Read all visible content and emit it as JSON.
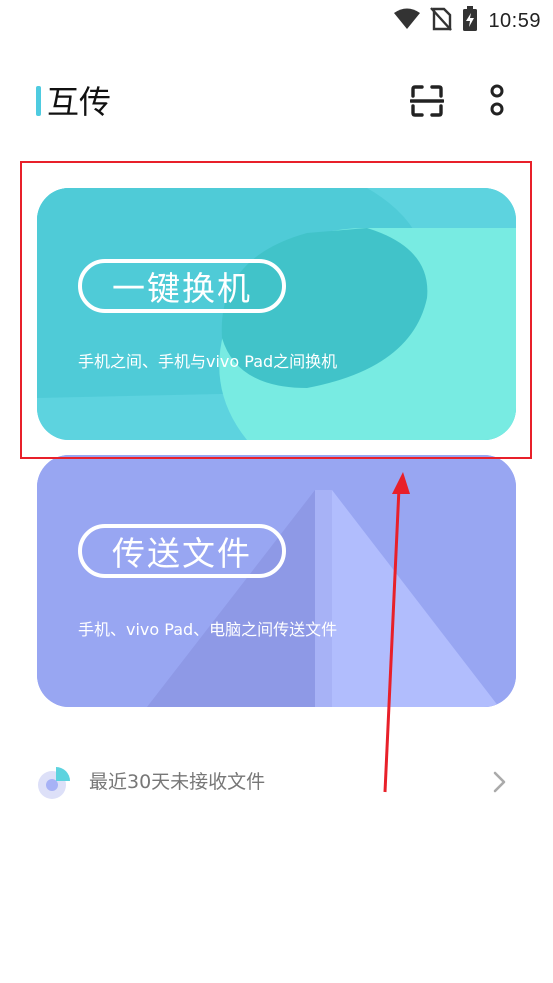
{
  "status_bar": {
    "time": "10:59",
    "icons": [
      "wifi-icon",
      "no-sim-icon",
      "battery-charging-icon"
    ]
  },
  "header": {
    "title": "互传",
    "icons": [
      "scan-icon",
      "more-vertical-icon"
    ]
  },
  "cards": [
    {
      "id": "phone-swap",
      "title": "一键换机",
      "description": "手机之间、手机与vivo Pad之间换机",
      "color": "#5dd3df"
    },
    {
      "id": "file-transfer",
      "title": "传送文件",
      "description": "手机、vivo Pad、电脑之间传送文件",
      "color": "#98a6f2"
    }
  ],
  "recent": {
    "label": "最近30天未接收文件",
    "icons": [
      "history-pie-icon",
      "chevron-right-icon"
    ]
  },
  "annotation": {
    "color": "#e8202a"
  }
}
